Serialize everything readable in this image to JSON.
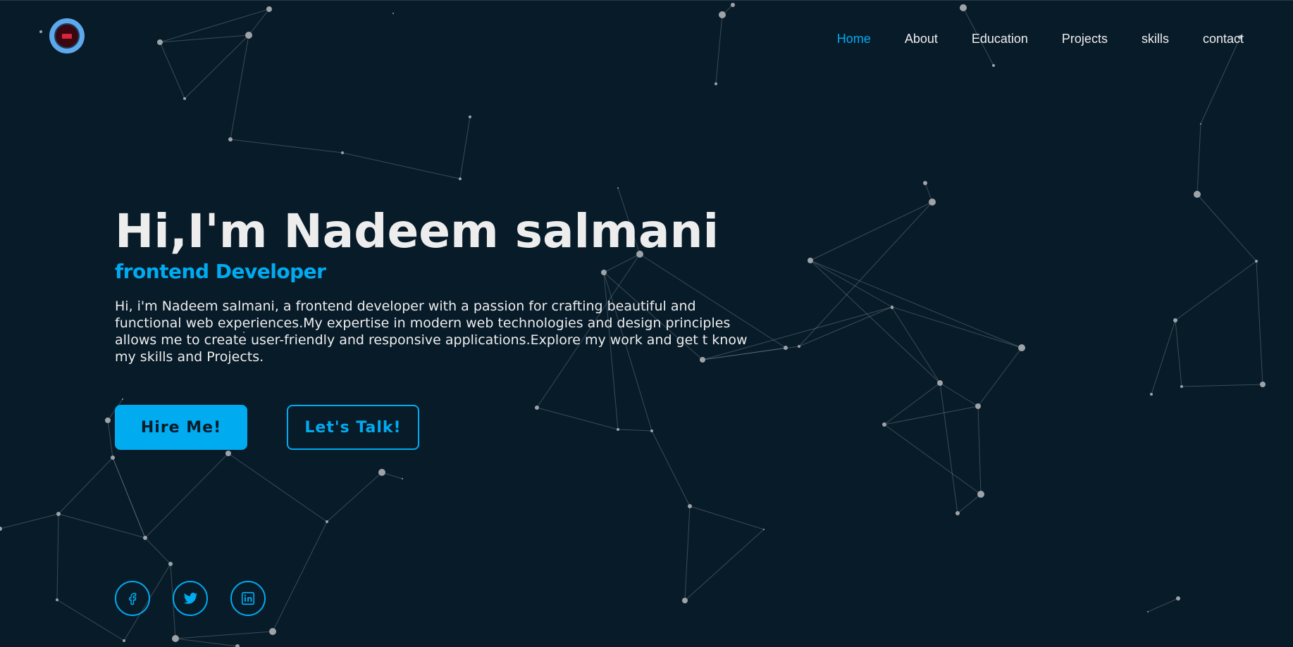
{
  "logo": {
    "icon": "logo-badge",
    "colors": {
      "ring": "#5ea8ec",
      "inner": "#3a0710",
      "mark": "#d6263a"
    }
  },
  "nav": {
    "items": [
      {
        "label": "Home",
        "active": true
      },
      {
        "label": "About",
        "active": false
      },
      {
        "label": "Education",
        "active": false
      },
      {
        "label": "Projects",
        "active": false
      },
      {
        "label": "skills",
        "active": false
      },
      {
        "label": "contact",
        "active": false
      }
    ]
  },
  "hero": {
    "title": "Hi,I'm Nadeem salmani",
    "subtitle": "frontend Developer",
    "description": "Hi, i'm Nadeem salmani, a frontend developer with a passion for crafting beautiful and functional web experiences.My expertise in modern web technologies and design principles allows me to create user-friendly and responsive applications.Explore my work and get t know my skills and Projects.",
    "buttons": {
      "hire": "Hire Me!",
      "talk": "Let's Talk!"
    }
  },
  "social": [
    {
      "icon": "facebook-icon"
    },
    {
      "icon": "twitter-icon"
    },
    {
      "icon": "linkedin-icon"
    }
  ],
  "colors": {
    "background": "#081b29",
    "accent": "#00abf0",
    "text": "#ededed",
    "particle": "#9aa0a6"
  }
}
